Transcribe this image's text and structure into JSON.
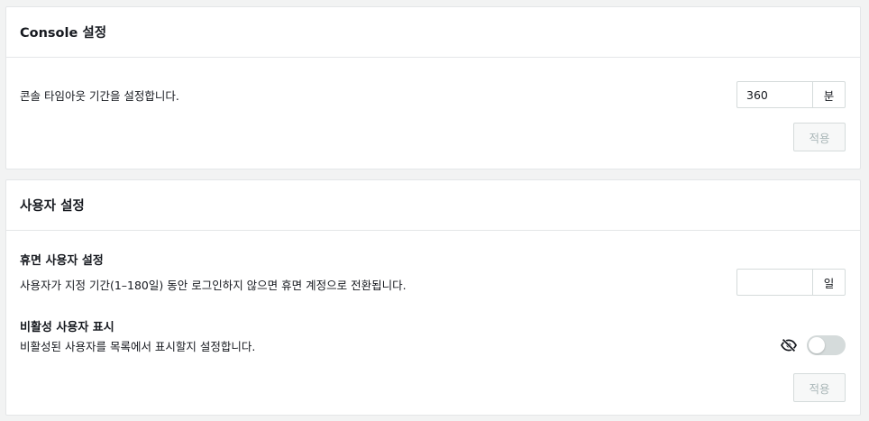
{
  "console_settings": {
    "title": "Console 설정",
    "description": "콘솔 타임아웃 기간을 설정합니다.",
    "timeout_value": "360",
    "timeout_unit": "분",
    "apply_label": "적용"
  },
  "user_settings": {
    "title": "사용자 설정",
    "dormant": {
      "heading": "휴면 사용자 설정",
      "description": "사용자가 지정 기간(1–180일) 동안 로그인하지 않으면 휴면 계정으로 전환됩니다.",
      "days_value": "",
      "days_unit": "일"
    },
    "inactive": {
      "heading": "비활성 사용자 표시",
      "description": "비활성된 사용자를 목록에서 표시할지 설정합니다.",
      "icon": "eye-slash-icon",
      "toggle_on": false
    },
    "apply_label": "적용"
  },
  "colors": {
    "page_bg": "#f2f3f3",
    "card_bg": "#ffffff",
    "border": "#e4e6e8",
    "disabled_text": "#aab7b8",
    "toggle_off": "#d5dbdb"
  }
}
